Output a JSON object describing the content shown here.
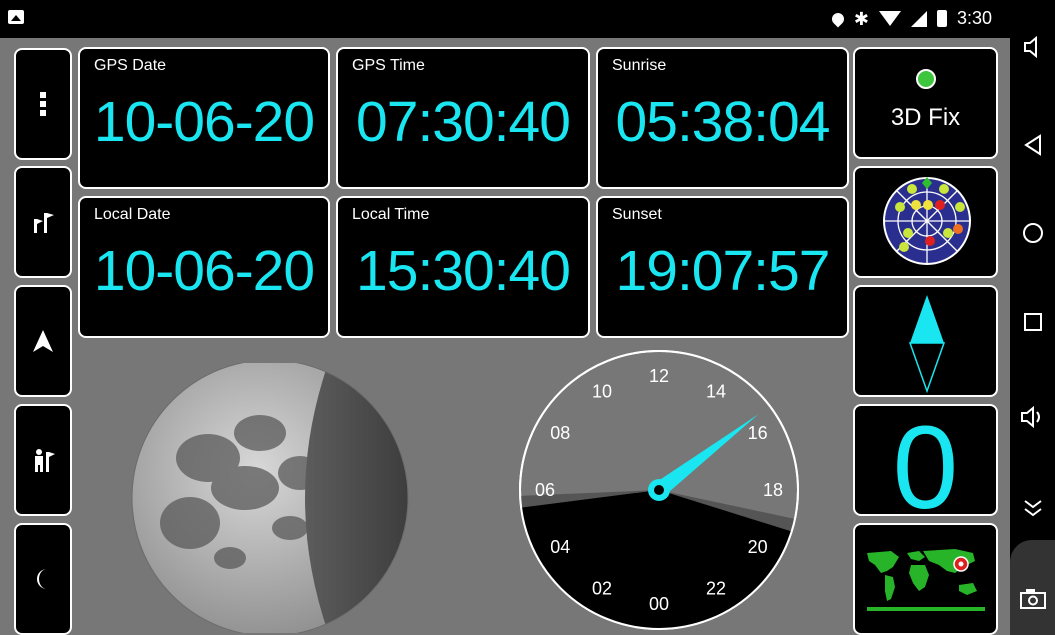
{
  "status_bar": {
    "icons": [
      "image-icon",
      "location-icon",
      "bluetooth-icon",
      "wifi-icon",
      "signal-icon",
      "battery-charging-icon"
    ],
    "time": "3:30"
  },
  "left_toolbar": {
    "buttons": [
      {
        "name": "more-menu-button",
        "icon": "vertical-dots-icon"
      },
      {
        "name": "waypoints-button",
        "icon": "flags-icon"
      },
      {
        "name": "navigation-button",
        "icon": "arrow-icon"
      },
      {
        "name": "tracking-button",
        "icon": "person-flag-icon"
      },
      {
        "name": "moon-button",
        "icon": "crescent-moon-icon"
      }
    ]
  },
  "info_tiles": [
    {
      "label": "GPS Date",
      "value": "10-06-20"
    },
    {
      "label": "GPS Time",
      "value": "07:30:40"
    },
    {
      "label": "Sunrise",
      "value": "05:38:04"
    },
    {
      "label": "Local Date",
      "value": "10-06-20"
    },
    {
      "label": "Local Time",
      "value": "15:30:40"
    },
    {
      "label": "Sunset",
      "value": "19:07:57"
    }
  ],
  "right_panel": {
    "fix_status": "3D Fix",
    "fix_color": "#3ec53e",
    "speed_value": "0",
    "accent_color": "#19e6f0"
  },
  "clock24": {
    "hour_labels": [
      "12",
      "14",
      "16",
      "18",
      "20",
      "22",
      "00",
      "02",
      "04",
      "06",
      "08",
      "10"
    ],
    "current_hour": 15.51
  },
  "moon": {
    "phase": "waxing gibbous"
  },
  "nav_bar": {
    "icons": [
      "volume-down-icon",
      "back-icon",
      "home-icon",
      "recents-icon",
      "volume-up-icon",
      "collapse-icon",
      "screenshot-icon"
    ]
  }
}
